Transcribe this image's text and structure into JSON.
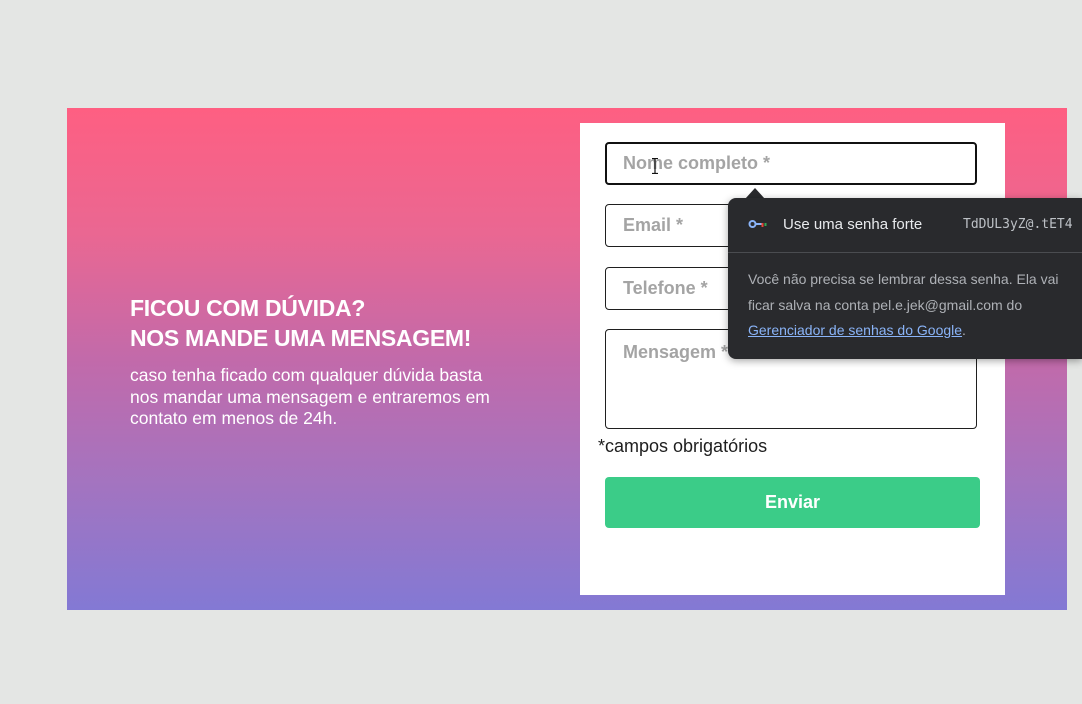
{
  "intro": {
    "title_line1": "FICOU COM DÚVIDA?",
    "title_line2": "NOS MANDE UMA MENSAGEM!",
    "text": "caso tenha ficado com qualquer dúvida basta nos mandar uma mensagem e entraremos em contato em menos de 24h."
  },
  "form": {
    "name_placeholder": "Nome completo *",
    "email_placeholder": "Email *",
    "phone_placeholder": "Telefone *",
    "message_placeholder": "Mensagem *",
    "required_note": "*campos obrigatórios",
    "submit_label": "Enviar"
  },
  "password_popup": {
    "icon": "key-icon",
    "label": "Use uma senha forte",
    "suggested_password": "TdDUL3yZ@.tET4",
    "desc_prefix": "Você não precisa se lembrar dessa senha. Ela vai ficar salva na conta pel.e.jek@gmail.com do ",
    "link_text": "Gerenciador de senhas do Google",
    "desc_suffix": "."
  },
  "colors": {
    "gradient_top": "#fe5f82",
    "gradient_bottom": "#8379d4",
    "submit": "#3bcc88",
    "popup_bg": "#292a2d",
    "link": "#8ab4f8"
  }
}
